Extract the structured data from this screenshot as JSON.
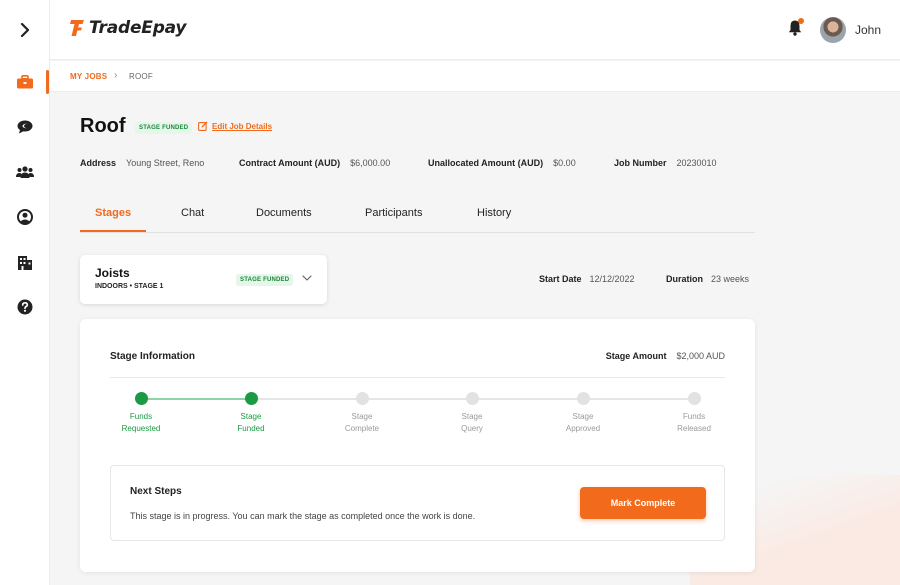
{
  "app": {
    "name": "TradeEpay"
  },
  "user": {
    "name": "John"
  },
  "colors": {
    "accent": "#f26a1b",
    "success": "#1a9a43",
    "badge_bg": "#e6f6ea"
  },
  "sidebar": {
    "items": [
      {
        "icon": "chevron-right-icon"
      },
      {
        "icon": "briefcase-icon",
        "active": true
      },
      {
        "icon": "chat-bubble-icon"
      },
      {
        "icon": "users-icon"
      },
      {
        "icon": "user-circle-icon"
      },
      {
        "icon": "building-icon"
      },
      {
        "icon": "help-icon"
      }
    ]
  },
  "breadcrumb": {
    "parent": "MY JOBS",
    "separator": "›",
    "current": "ROOF"
  },
  "job": {
    "title": "Roof",
    "status": "STAGE FUNDED",
    "edit_label": "Edit Job Details",
    "address_label": "Address",
    "address_value": "Young Street, Reno",
    "contract_label": "Contract Amount (AUD)",
    "contract_value": "$6,000.00",
    "unallocated_label": "Unallocated Amount (AUD)",
    "unallocated_value": "$0.00",
    "job_number_label": "Job Number",
    "job_number_value": "20230010"
  },
  "tabs": [
    {
      "label": "Stages",
      "active": true
    },
    {
      "label": "Chat"
    },
    {
      "label": "Documents"
    },
    {
      "label": "Participants"
    },
    {
      "label": "History"
    }
  ],
  "stage": {
    "name": "Joists",
    "subtitle": "INDOORS • STAGE 1",
    "status": "STAGE FUNDED",
    "start_date_label": "Start Date",
    "start_date_value": "12/12/2022",
    "duration_label": "Duration",
    "duration_value": "23 weeks"
  },
  "stage_info": {
    "title": "Stage Information",
    "amount_label": "Stage Amount",
    "amount_value": "$2,000 AUD",
    "progress": [
      {
        "label": "Funds\nRequested",
        "done": true
      },
      {
        "label": "Stage\nFunded",
        "done": true
      },
      {
        "label": "Stage\nComplete",
        "done": false
      },
      {
        "label": "Stage\nQuery",
        "done": false
      },
      {
        "label": "Stage\nApproved",
        "done": false
      },
      {
        "label": "Funds\nReleased",
        "done": false
      }
    ]
  },
  "next_steps": {
    "title": "Next Steps",
    "text": "This stage is in progress. You can mark the stage as completed once the work is done.",
    "button_label": "Mark Complete"
  }
}
